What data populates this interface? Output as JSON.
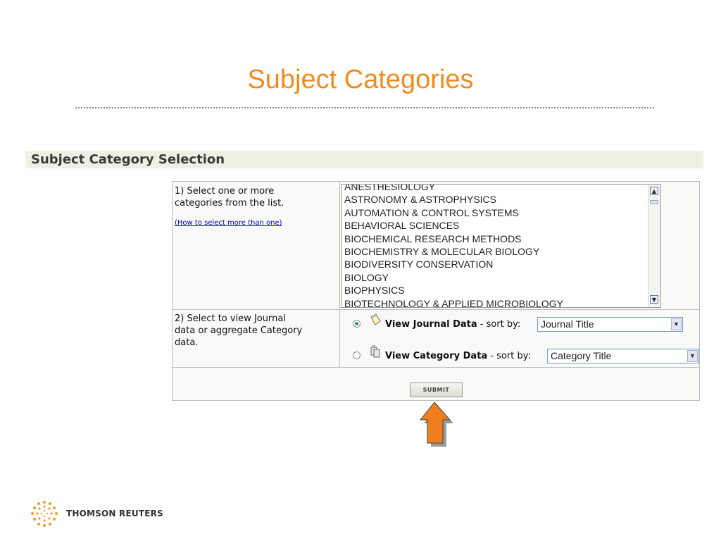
{
  "slide": {
    "title": "Subject Categories"
  },
  "section": {
    "title": "Subject Category Selection"
  },
  "step1": {
    "label_line1": "1) Select one or more",
    "label_line2": "categories from the list.",
    "help_link": "(How to select more than one)"
  },
  "category_list": {
    "items": [
      "ANESTHESIOLOGY",
      "ASTRONOMY & ASTROPHYSICS",
      "AUTOMATION & CONTROL SYSTEMS",
      "BEHAVIORAL SCIENCES",
      "BIOCHEMICAL RESEARCH METHODS",
      "BIOCHEMISTRY & MOLECULAR BIOLOGY",
      "BIODIVERSITY CONSERVATION",
      "BIOLOGY",
      "BIOPHYSICS",
      "BIOTECHNOLOGY & APPLIED MICROBIOLOGY"
    ]
  },
  "step2": {
    "label_line1": "2) Select to view Journal",
    "label_line2": "data or aggregate Category",
    "label_line3": "data.",
    "journal_option": {
      "label": "View Journal Data",
      "sort_text": "- sort by:",
      "selected": true,
      "sort_value": "Journal Title",
      "icon": "journal-icon"
    },
    "category_option": {
      "label": "View Category Data",
      "sort_text": "- sort by:",
      "selected": false,
      "sort_value": "Category Title",
      "icon": "category-icon"
    }
  },
  "submit": {
    "label": "SUBMIT"
  },
  "annotation": {
    "icon": "arrow-up-icon",
    "color": "#f07d1e"
  },
  "footer": {
    "logo_text": "THOMSON REUTERS"
  },
  "colors": {
    "title": "#f28a1e",
    "section_bar": "#efefe4",
    "link": "#0000cc"
  }
}
